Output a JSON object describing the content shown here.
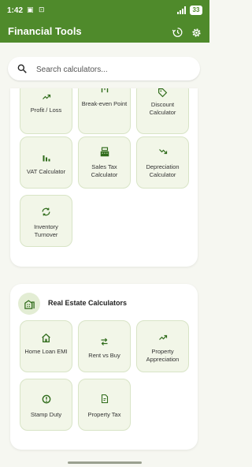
{
  "status_bar": {
    "time": "1:42",
    "battery": "33",
    "left_icons": "▣ ⊡"
  },
  "app_bar": {
    "title": "Financial Tools"
  },
  "search": {
    "placeholder": "Search calculators..."
  },
  "business_tools": [
    {
      "label": "Profit / Loss",
      "icon": "trending-up-icon"
    },
    {
      "label": "Break-even Point",
      "icon": "break-even-icon"
    },
    {
      "label": "Discount Calculator",
      "icon": "tag-icon"
    },
    {
      "label": "VAT Calculator",
      "icon": "bar-chart-icon"
    },
    {
      "label": "Sales Tax Calculator",
      "icon": "cash-register-icon"
    },
    {
      "label": "Depreciation Calculator",
      "icon": "trending-down-icon"
    },
    {
      "label": "Inventory Turnover",
      "icon": "refresh-icon"
    }
  ],
  "real_estate": {
    "title": "Real Estate Calculators",
    "icon": "city-icon",
    "items": [
      {
        "label": "Home Loan EMI",
        "icon": "home-icon"
      },
      {
        "label": "Rent vs Buy",
        "icon": "swap-icon"
      },
      {
        "label": "Property Appreciation",
        "icon": "trending-up-icon"
      },
      {
        "label": "Stamp Duty",
        "icon": "seal-icon"
      },
      {
        "label": "Property Tax",
        "icon": "receipt-icon"
      }
    ]
  },
  "colors": {
    "primary": "#4f8a2b",
    "tile_bg": "#f2f6e8",
    "tile_border": "#d8e4c6",
    "background": "#f6f7f1"
  }
}
